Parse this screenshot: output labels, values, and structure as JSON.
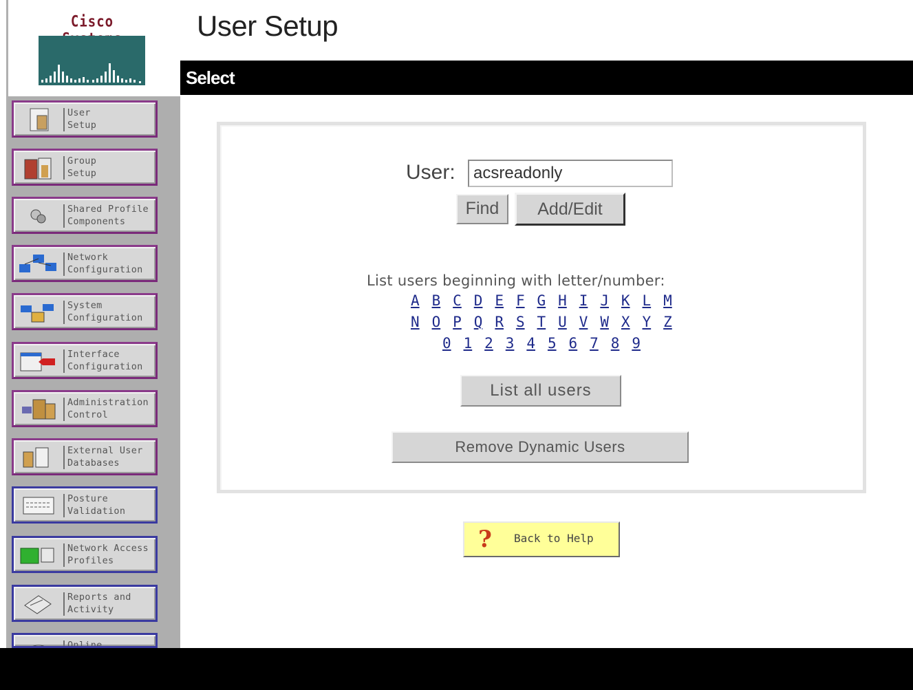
{
  "brand": "Cisco Systems",
  "page_title": "User Setup",
  "section_title": "Select",
  "sidebar": {
    "items": [
      {
        "label": "User\nSetup",
        "icon": "user-setup-icon"
      },
      {
        "label": "Group\nSetup",
        "icon": "group-setup-icon"
      },
      {
        "label": "Shared Profile\nComponents",
        "icon": "shared-profile-icon"
      },
      {
        "label": "Network\nConfiguration",
        "icon": "network-config-icon"
      },
      {
        "label": "System\nConfiguration",
        "icon": "system-config-icon"
      },
      {
        "label": "Interface\nConfiguration",
        "icon": "interface-config-icon"
      },
      {
        "label": "Administration\nControl",
        "icon": "admin-control-icon"
      },
      {
        "label": "External User\nDatabases",
        "icon": "external-db-icon"
      },
      {
        "label": "Posture\nValidation",
        "icon": "posture-validation-icon"
      },
      {
        "label": "Network Access\nProfiles",
        "icon": "network-access-profiles-icon"
      },
      {
        "label": "Reports and\nActivity",
        "icon": "reports-activity-icon"
      },
      {
        "label": "Online",
        "icon": "online-docs-icon"
      }
    ]
  },
  "form": {
    "user_label": "User:",
    "user_value": "acsreadonly",
    "find_label": "Find",
    "addedit_label": "Add/Edit",
    "list_prompt": "List users beginning with letter/number:",
    "letters_row1": [
      "A",
      "B",
      "C",
      "D",
      "E",
      "F",
      "G",
      "H",
      "I",
      "J",
      "K",
      "L",
      "M"
    ],
    "letters_row2": [
      "N",
      "O",
      "P",
      "Q",
      "R",
      "S",
      "T",
      "U",
      "V",
      "W",
      "X",
      "Y",
      "Z"
    ],
    "digits_row": [
      "0",
      "1",
      "2",
      "3",
      "4",
      "5",
      "6",
      "7",
      "8",
      "9"
    ],
    "list_all_label": "List all users",
    "remove_dynamic_label": "Remove Dynamic Users"
  },
  "help": {
    "label": "Back to Help"
  }
}
